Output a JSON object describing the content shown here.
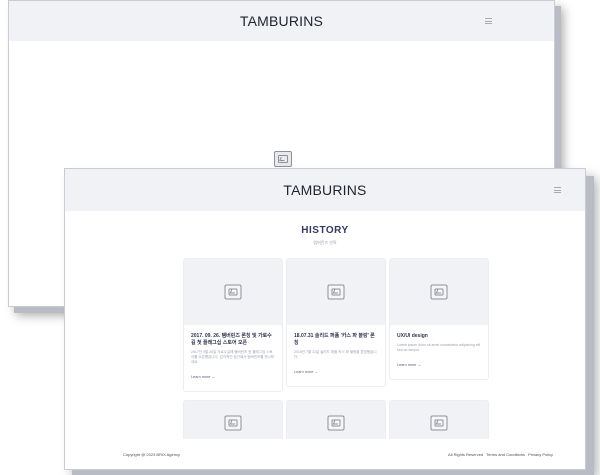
{
  "back_window": {
    "brand": "TAMBURINS"
  },
  "front_window": {
    "brand": "TAMBURINS",
    "history": {
      "title": "HISTORY",
      "subtitle": "탬버린즈 연혁"
    },
    "cards": [
      {
        "title": "2017. 09. 26. 탬버린즈 론칭 및 가로수길 첫 플래그십 스토어 오픈",
        "text": "2017년 9월 26일 가로수길에 탬버린즈 첫 플래그십 스토어를 오픈했습니다. 감각적인 공간에서 탬버린즈를 만나보세요.",
        "link": "Learn more →"
      },
      {
        "title": "18.07.31 솔리드 퍼퓸 '카스 파 블랑' 론칭",
        "text": "2018년 7월 31일 솔리드 퍼퓸 카스 파 블랑을 론칭했습니다.",
        "link": "Learn more →"
      },
      {
        "title": "UX/UI design",
        "text": "Lorem ipsum dolor sit amet consectetur adipiscing elit sed do tempor.",
        "link": "Learn more →"
      },
      {
        "title": "",
        "text": "",
        "link": ""
      },
      {
        "title": "",
        "text": "",
        "link": ""
      },
      {
        "title": "",
        "text": "",
        "link": ""
      }
    ],
    "footer": {
      "copyright": "Copyright @ 2023 BRIX Agency",
      "rights": "All Rights Reserved",
      "terms": "Terms and Conditions",
      "privacy": "Privacy Policy"
    }
  },
  "icons": {
    "image_placeholder": "image-icon",
    "menu": "hamburger-menu-icon"
  },
  "colors": {
    "header_bg": "#f1f2f5",
    "title": "#343a60",
    "muted_text": "#9ba0ae"
  }
}
